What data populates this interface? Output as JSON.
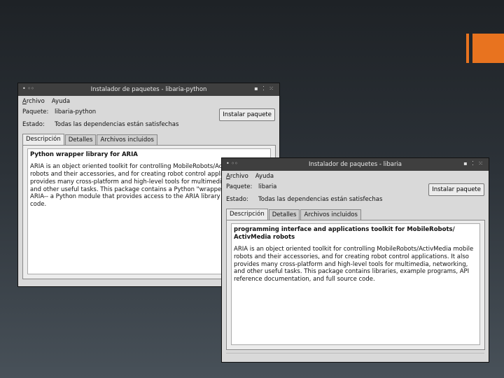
{
  "windows": [
    {
      "title": "Instalador de paquetes - libaria-python",
      "menu": [
        {
          "accel": "A",
          "rest": "rchivo"
        },
        {
          "accel": "",
          "rest": "Ayuda"
        }
      ],
      "paquete_label": "Paquete:",
      "paquete_value": "libaria-python",
      "estado_label": "Estado:",
      "estado_value": "Todas las dependencias están satisfechas",
      "install_label": "Instalar paquete",
      "tabs": [
        "Descripción",
        "Detalles",
        "Archivos incluidos"
      ],
      "heading": "Python wrapper library for ARIA",
      "body": "ARIA is an object oriented toolkit for controlling MobileRobots/ActivMedia robots and their accessories, and for creating robot control applications. It provides many cross-platform and high-level tools for multimedia, networking, and other useful tasks. This package contains a Python \"wrapper\" library for ARIA-- a Python module that provides access to the ARIA library from Python code."
    },
    {
      "title": "Instalador de paquetes - libaria",
      "menu": [
        {
          "accel": "A",
          "rest": "rchivo"
        },
        {
          "accel": "",
          "rest": "Ayuda"
        }
      ],
      "paquete_label": "Paquete:",
      "paquete_value": "libaria",
      "estado_label": "Estado:",
      "estado_value": "Todas las dependencias están satisfechas",
      "install_label": "Instalar paquete",
      "tabs": [
        "Descripción",
        "Detalles",
        "Archivos incluidos"
      ],
      "heading": "programming interface and applications toolkit for MobileRobots/ ActivMedia robots",
      "body": "ARIA is an object oriented toolkit for controlling MobileRobots/ActivMedia mobile robots and their accessories, and for creating robot control applications. It also provides many cross-platform and high-level tools for multimedia, networking, and other useful tasks. This package contains libraries, example programs, API reference documentation, and full source code."
    }
  ],
  "colors": {
    "accent": "#e8731f",
    "titlebar": "#3f3f3f",
    "window_bg": "#d9d9d9"
  }
}
